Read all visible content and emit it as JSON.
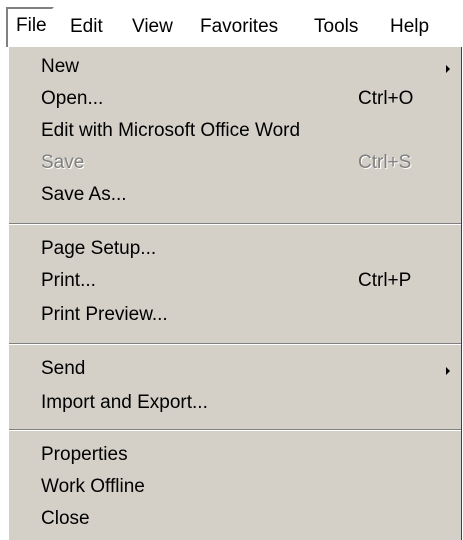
{
  "menubar": {
    "items": [
      {
        "label": "File"
      },
      {
        "label": "Edit"
      },
      {
        "label": "View"
      },
      {
        "label": "Favorites"
      },
      {
        "label": "Tools"
      },
      {
        "label": "Help"
      }
    ]
  },
  "file_menu": {
    "new": {
      "label": "New"
    },
    "open": {
      "label": "Open...",
      "shortcut": "Ctrl+O"
    },
    "edit_word": {
      "label": "Edit with Microsoft Office Word"
    },
    "save": {
      "label": "Save",
      "shortcut": "Ctrl+S",
      "enabled": false
    },
    "save_as": {
      "label": "Save As..."
    },
    "page_setup": {
      "label": "Page Setup..."
    },
    "print": {
      "label": "Print...",
      "shortcut": "Ctrl+P"
    },
    "print_preview": {
      "label": "Print Preview..."
    },
    "send": {
      "label": "Send"
    },
    "import_export": {
      "label": "Import and Export..."
    },
    "properties": {
      "label": "Properties"
    },
    "work_offline": {
      "label": "Work Offline"
    },
    "close": {
      "label": "Close"
    }
  },
  "colors": {
    "menu_background": "#d4d0c8",
    "disabled_text": "#808080"
  },
  "icons": {
    "submenu_arrow": "chevron-right-icon"
  }
}
